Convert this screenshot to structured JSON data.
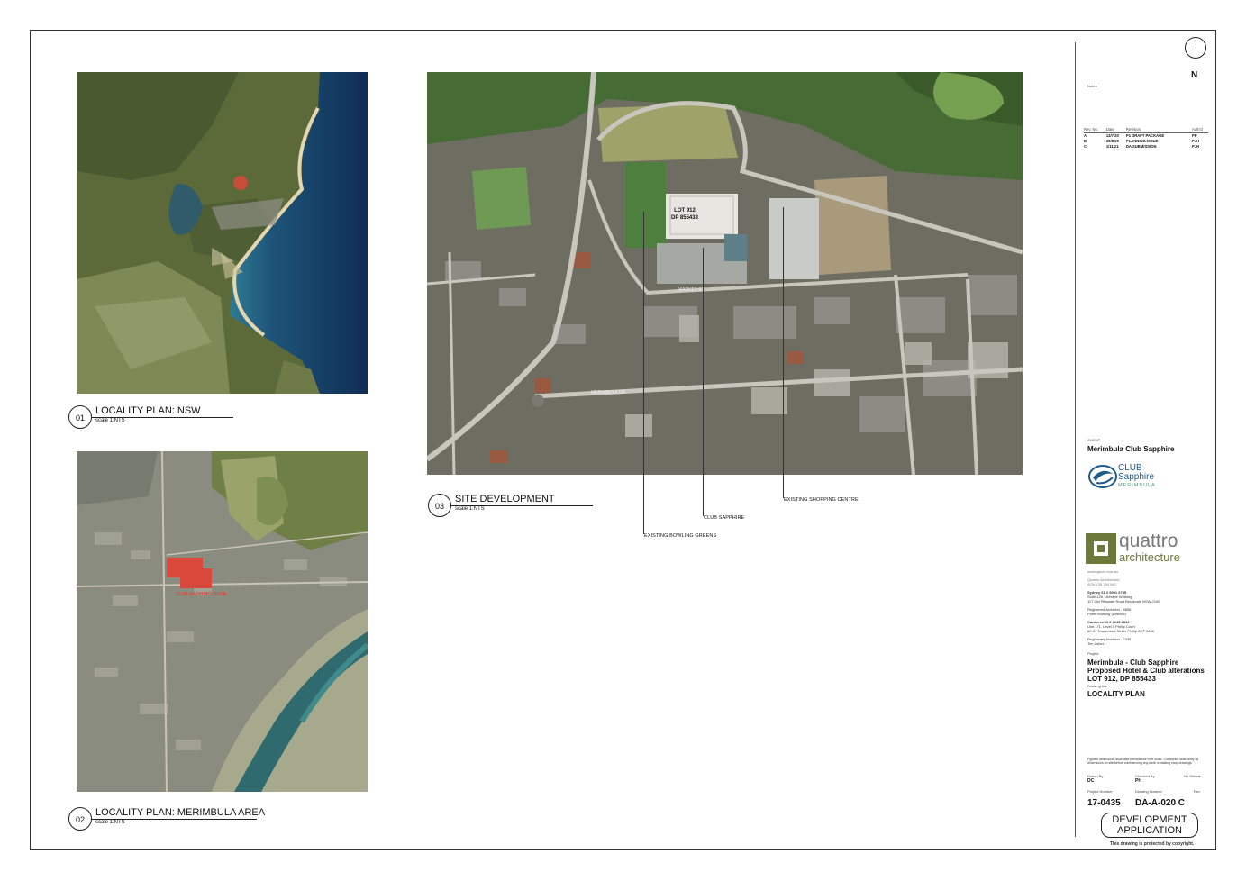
{
  "views": {
    "v01": {
      "number": "01",
      "title": "LOCALITY PLAN: NSW",
      "scale": "scale 1:NTS"
    },
    "v02": {
      "number": "02",
      "title": "LOCALITY PLAN: MERIMBULA AREA",
      "scale": "scale 1:NTS"
    },
    "v03": {
      "number": "03",
      "title": "SITE DEVELOPMENT",
      "scale": "scale 1:NTS"
    }
  },
  "site_map": {
    "lot_label": "LOT 912",
    "dp_label": "DP 855433",
    "street_labels": [
      "MERIMBULA DR",
      "MARKET ST"
    ],
    "callouts": [
      "EXISTING BOWLING GREENS",
      "CLUB SAPPHIRE",
      "EXISTING SHOPPING CENTRE"
    ]
  },
  "merimbula_map": {
    "highlight_label": "CLUB SAPPHIRE CLUB"
  },
  "title_block": {
    "north_label": "N",
    "notes_label": "Notes",
    "revisions": {
      "headers": [
        "Rev. No.",
        "Date",
        "Revision",
        "Auth'd"
      ],
      "rows": [
        [
          "A",
          "13/7/20",
          "P1 DRAFT PACKAGE",
          "PP"
        ],
        [
          "B",
          "29/8/20",
          "PLANNING ISSUE",
          "PJH"
        ],
        [
          "C",
          "1/11/21",
          "DA SUBMISSION",
          "PJH"
        ]
      ]
    },
    "client_label": "CLIENT",
    "client_name": "Merimbula Club Sapphire",
    "club_logo": {
      "line1": "CLUB",
      "line2": "Sapphire",
      "line3": "MERIMBULA"
    },
    "architect_logo": {
      "word1": "quattro",
      "word2": "architecture"
    },
    "architect_details": [
      "www.qarch.com.au",
      "Quattro Architecture",
      "ACN 135 704 942",
      "Sydney   61 2 9091 6785",
      "Suite 128, Lifestyle Working",
      "117 Old Pittwater Road Brookvale NSW 2100",
      "Registered Architect - 8856",
      "Peter Hooking (Director)",
      "Canberra   61 2 6245 1833",
      "Unit 171, Level 1 Phillip Court",
      "60-97 Townshend Street Phillip ACT 2606",
      "Registered Architect - 2338",
      "Tim Zuber"
    ],
    "project_label": "Project",
    "project_lines": [
      "Merimbula - Club Sapphire",
      "Proposed Hotel & Club alterations",
      "LOT 912, DP 855433"
    ],
    "drawing_title_label": "Drawing title",
    "drawing_title": "LOCALITY PLAN",
    "disclaimer": [
      "Figured dimensions shall take precedence over scale. Contractor must verify all",
      "dimensions on site before commencing any work or making shop drawings."
    ],
    "drawn_by_label": "Drawn By",
    "drawn_by": "DC",
    "checked_by_label": "Checked By",
    "checked_by": "PH",
    "no_sheets_label": "No Sheets",
    "project_number_label": "Project Number",
    "project_number": "17-0435",
    "drawing_number_label": "Drawing Number",
    "drawing_number": "DA-A-020 C",
    "rev_label": "Rev",
    "stamp_line1": "DEVELOPMENT",
    "stamp_line2": "APPLICATION",
    "copyright": "This drawing is protected by copyright."
  },
  "colors": {
    "ocean": "#163b63",
    "land": "#5d6b3b",
    "urban": "#8a8a80",
    "highlight": "#d9483b",
    "club_logo_blue": "#1f5a8a",
    "quattro_green": "#6b7a3a"
  }
}
